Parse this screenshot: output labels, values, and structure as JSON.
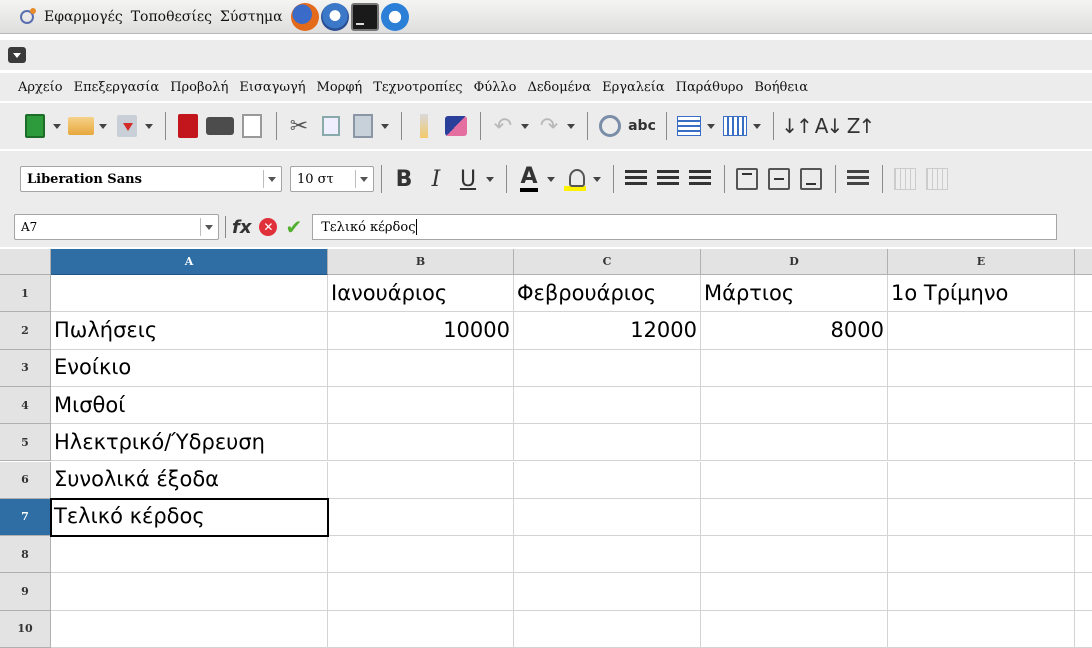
{
  "panel": {
    "menus": [
      "Εφαρμογές",
      "Τοποθεσίες",
      "Σύστημα"
    ],
    "launchers": [
      "firefox-icon",
      "thunderbird-icon",
      "terminal-icon",
      "browser-icon"
    ]
  },
  "menubar": {
    "items": [
      "Αρχείο",
      "Επεξεργασία",
      "Προβολή",
      "Εισαγωγή",
      "Μορφή",
      "Τεχνοτροπίες",
      "Φύλλο",
      "Δεδομένα",
      "Εργαλεία",
      "Παράθυρο",
      "Βοήθεια"
    ]
  },
  "formatting": {
    "font_name": "Liberation Sans",
    "font_size": "10 στ"
  },
  "formula_bar": {
    "cell_ref": "A7",
    "content": "Τελικό κέρδος",
    "fx_label": "fx"
  },
  "sheet": {
    "columns": [
      "A",
      "B",
      "C",
      "D",
      "E"
    ],
    "rows": [
      "1",
      "2",
      "3",
      "4",
      "5",
      "6",
      "7",
      "8",
      "9",
      "10"
    ],
    "cells": {
      "B1": "Ιανουάριος",
      "C1": "Φεβρουάριος",
      "D1": "Μάρτιος",
      "E1": "1ο Τρίμηνο",
      "A2": "Πωλήσεις",
      "B2": "10000",
      "C2": "12000",
      "D2": "8000",
      "A3": "Ενοίκιο",
      "A4": "Μισθοί",
      "A5": "Ηλεκτρικό/Ύδρευση",
      "A6": "Συνολικά έξοδα",
      "A7": "Τελικό κέρδος"
    },
    "active_cell": "A7",
    "numeric_cells": [
      "B2",
      "C2",
      "D2"
    ]
  }
}
